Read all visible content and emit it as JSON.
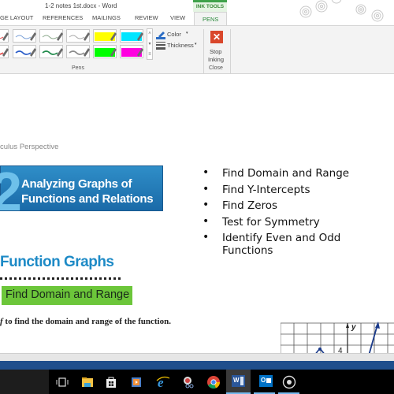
{
  "window": {
    "title": "1-2 notes 1st.docx - Word",
    "contextual_tab_group": "INK TOOLS"
  },
  "tabs": [
    {
      "label": "GE LAYOUT",
      "active": false
    },
    {
      "label": "REFERENCES",
      "active": false
    },
    {
      "label": "MAILINGS",
      "active": false
    },
    {
      "label": "REVIEW",
      "active": false
    },
    {
      "label": "VIEW",
      "active": false
    },
    {
      "label": "PENS",
      "active": true
    }
  ],
  "ribbon": {
    "pens_group_label": "Pens",
    "pens": [
      {
        "type": "pen",
        "color": "#e23a3a"
      },
      {
        "type": "pen",
        "color": "#7aa0d8"
      },
      {
        "type": "pen",
        "color": "#8aa88a"
      },
      {
        "type": "pen",
        "color": "#a8a8a8"
      },
      {
        "type": "highlighter",
        "color": "#ffff00"
      },
      {
        "type": "highlighter",
        "color": "#00e5ff"
      },
      {
        "type": "pen",
        "color": "#e23a3a"
      },
      {
        "type": "pen",
        "color": "#2a5cc8"
      },
      {
        "type": "pen",
        "color": "#1f8a4a"
      },
      {
        "type": "pen",
        "color": "#8a8a8a"
      },
      {
        "type": "highlighter",
        "color": "#00ff00"
      },
      {
        "type": "highlighter",
        "color": "#ff00e0"
      }
    ],
    "color_label": "Color",
    "thickness_label": "Thickness",
    "stop_inking_line1": "Stop",
    "stop_inking_line2": "Inking",
    "close_group_label": "Close"
  },
  "document": {
    "subheading": "culus Perspective",
    "banner_number": "2",
    "banner_line1": "Analyzing Graphs of",
    "banner_line2": "Functions and Relations",
    "bullets": [
      "Find Domain and Range",
      "Find Y-Intercepts",
      "Find Zeros",
      "Test for Symmetry",
      "Identify Even and Odd Functions"
    ],
    "section_title": "Function Graphs",
    "green_heading": "Find Domain and Range",
    "instruction_prefix": "f ",
    "instruction_var": "f",
    "instruction_rest": " to find the domain and range of the function.",
    "graph_y_label": "y",
    "graph_tick_label": "4"
  },
  "taskbar": {
    "apps": [
      {
        "name": "task-view"
      },
      {
        "name": "file-explorer"
      },
      {
        "name": "store"
      },
      {
        "name": "media-player"
      },
      {
        "name": "internet-explorer"
      },
      {
        "name": "snipping-tool"
      },
      {
        "name": "chrome"
      },
      {
        "name": "word",
        "active": true
      },
      {
        "name": "outlook"
      },
      {
        "name": "cortana-record"
      }
    ],
    "word_icon_text": "W",
    "outlook_icon_text": "O"
  }
}
